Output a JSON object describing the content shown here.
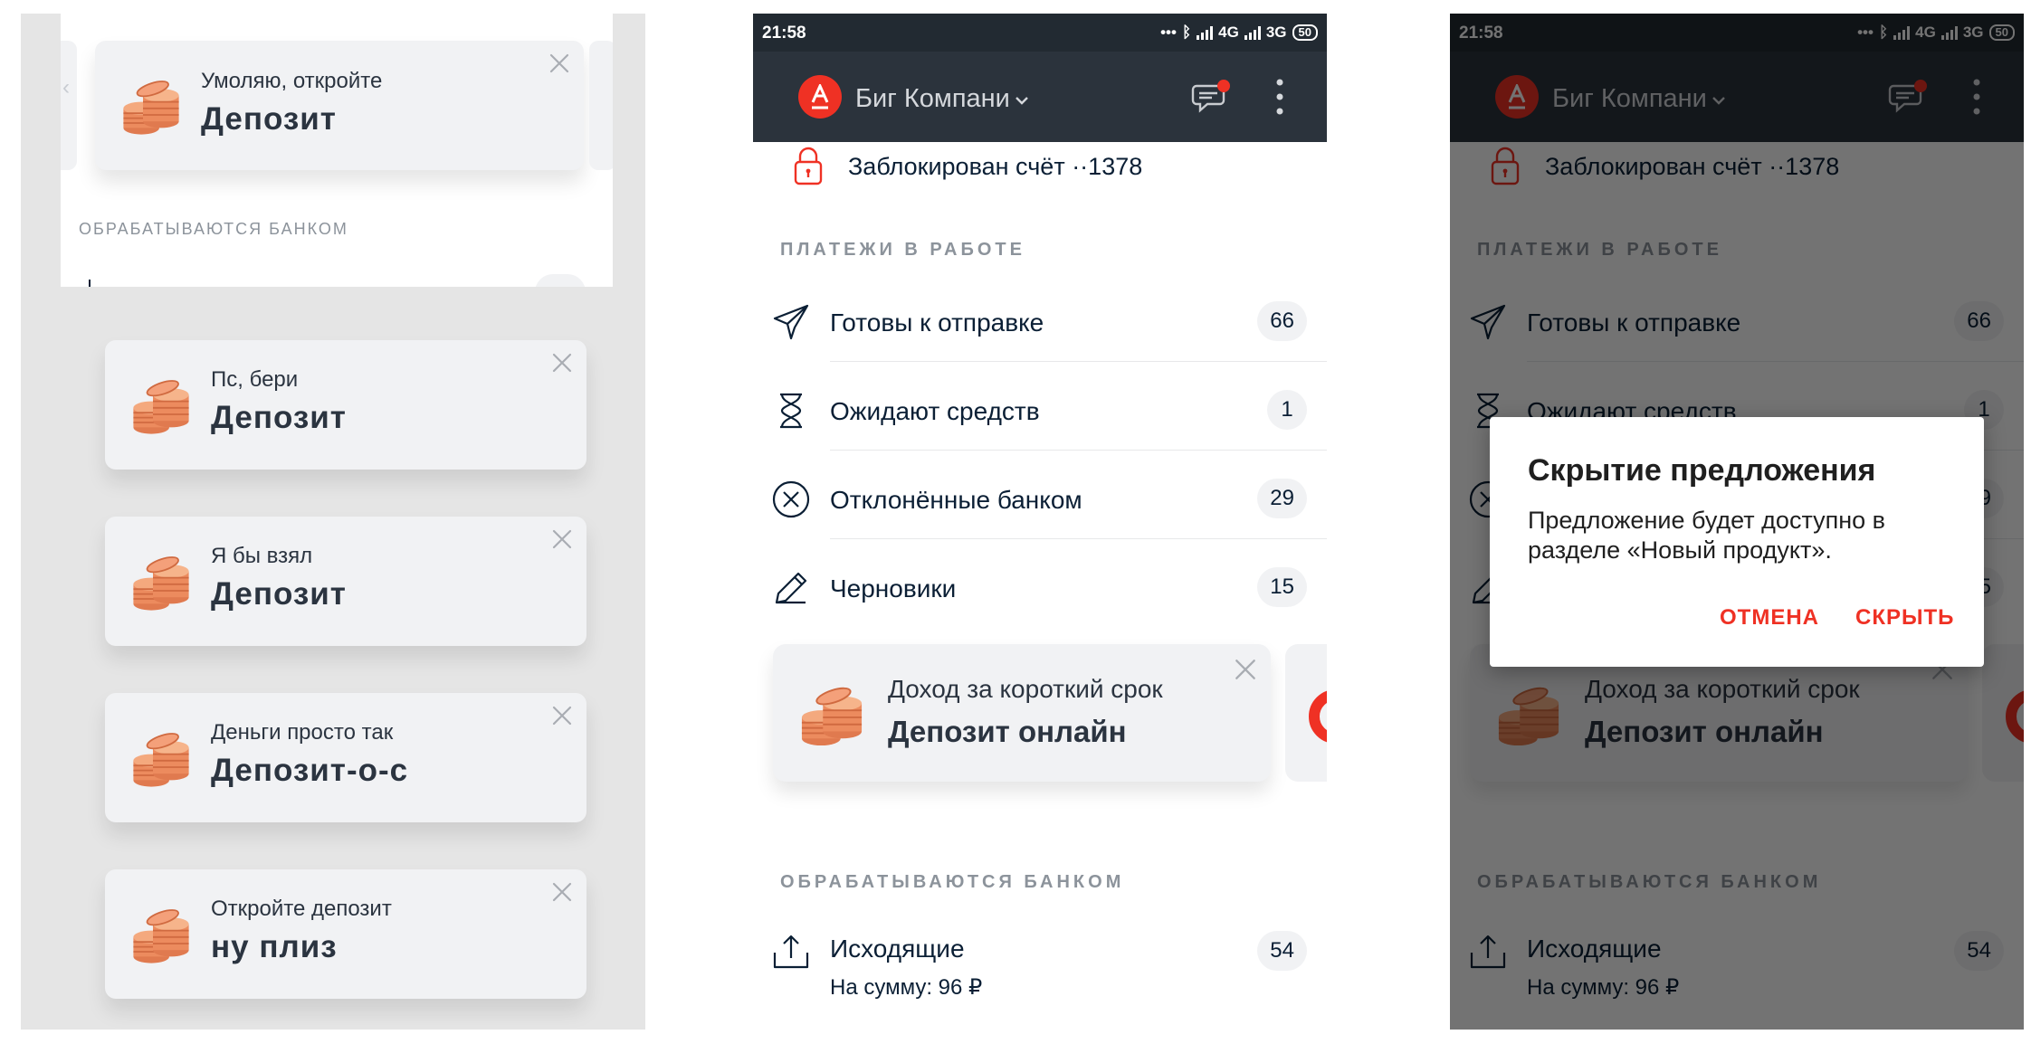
{
  "left_panel": {
    "top_card": {
      "promo": {
        "title": "Умоляю, откройте",
        "product": "Депозит"
      },
      "section_title": "ОБРАБАТЫВАЮТСЯ БАНКОМ"
    },
    "promos": [
      {
        "title": "Пс, бери",
        "product": "Депозит"
      },
      {
        "title": "Я бы взял",
        "product": "Депозит"
      },
      {
        "title": "Деньги просто так",
        "product": "Депозит-о-с"
      },
      {
        "title": "Откройте депозит",
        "product": "ну плиз"
      }
    ]
  },
  "phone": {
    "status": {
      "time": "21:58",
      "dots": "•••",
      "net1": "4G",
      "net2": "3G",
      "battery": "50"
    },
    "app_bar": {
      "company": "Биг Компани",
      "avatar_letter": "A"
    },
    "blocked_notice": "Заблокирован счёт ··1378",
    "payments_section": {
      "title": "ПЛАТЕЖИ В РАБОТЕ",
      "rows": [
        {
          "icon": "paper-plane-icon",
          "label": "Готовы к отправке",
          "count": "66"
        },
        {
          "icon": "hourglass-icon",
          "label": "Ожидают средств",
          "count": "1"
        },
        {
          "icon": "cancel-circle-icon",
          "label": "Отклонённые банком",
          "count": "29"
        },
        {
          "icon": "pencil-icon",
          "label": "Черновики",
          "count": "15"
        }
      ]
    },
    "promo": {
      "title": "Доход за короткий срок",
      "product": "Депозит онлайн"
    },
    "bank_section": {
      "title": "ОБРАБАТЫВАЮТСЯ БАНКОМ",
      "outgoing": {
        "label": "Исходящие",
        "sum": "На сумму: 96 ₽",
        "count": "54"
      }
    }
  },
  "dialog": {
    "title": "Скрытие предложения",
    "text": "Предложение будет доступно в разделе «Новый продукт».",
    "cancel": "ОТМЕНА",
    "confirm": "СКРЫТЬ"
  },
  "colors": {
    "brand_red": "#EF3124",
    "dark_bar": "#2B333C",
    "status_bar": "#222A32",
    "card_bg": "#F1F2F4",
    "text": "#0B1F35",
    "section_grey": "#8C939B"
  }
}
